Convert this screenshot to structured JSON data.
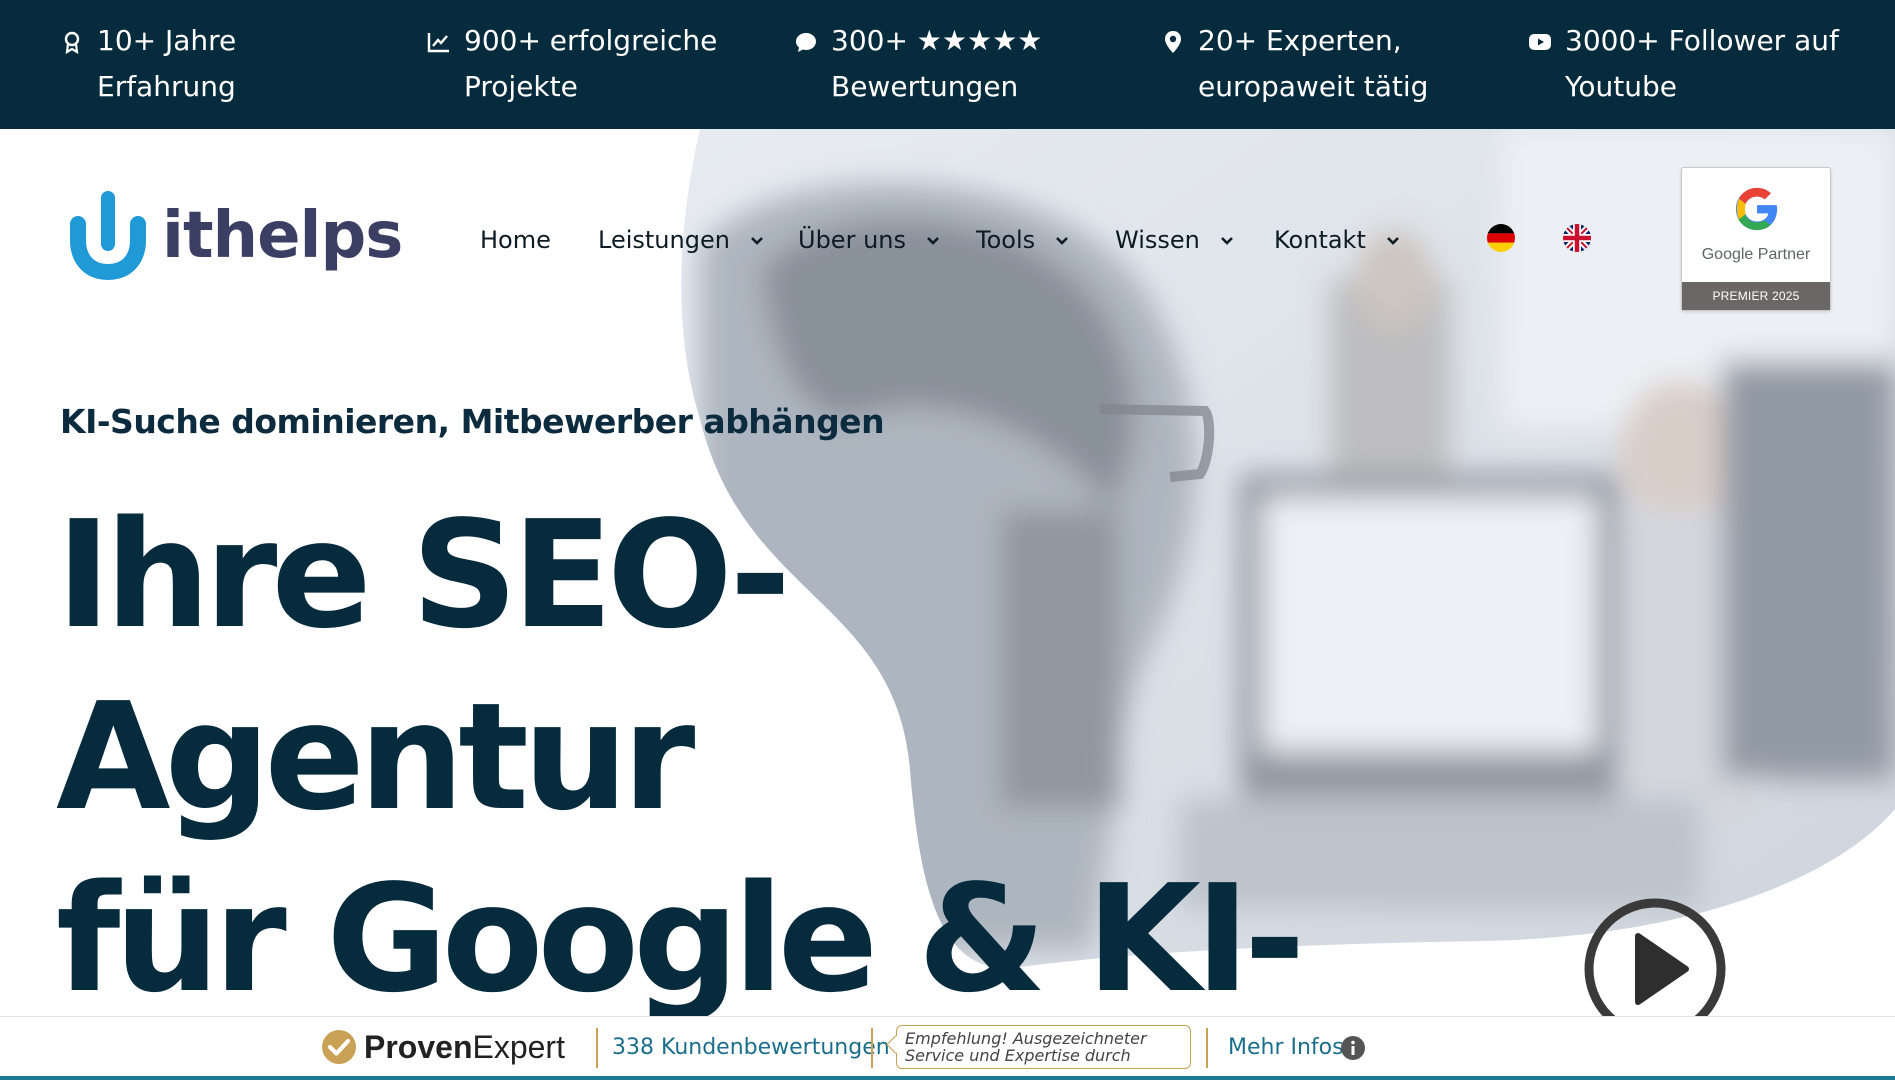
{
  "topbar": {
    "stats": [
      {
        "icon": "award-icon",
        "line1": "10+ Jahre",
        "line2": "Erfahrung"
      },
      {
        "icon": "chart-icon",
        "line1": "900+ erfolgreiche",
        "line2": "Projekte"
      },
      {
        "icon": "chat-bubble-icon",
        "line1": "300+ ★★★★★",
        "line2": "Bewertungen"
      },
      {
        "icon": "location-pin-icon",
        "line1": "20+ Experten,",
        "line2": "europaweit tätig"
      },
      {
        "icon": "youtube-icon",
        "line1": "3000+ Follower auf",
        "line2": "Youtube"
      }
    ]
  },
  "header": {
    "logo_text": "ithelps",
    "nav": [
      {
        "label": "Home",
        "has_dropdown": false
      },
      {
        "label": "Leistungen",
        "has_dropdown": true
      },
      {
        "label": "Über uns",
        "has_dropdown": true
      },
      {
        "label": "Tools",
        "has_dropdown": true
      },
      {
        "label": "Wissen",
        "has_dropdown": true
      },
      {
        "label": "Kontakt",
        "has_dropdown": true
      }
    ],
    "languages": [
      "german-flag-icon",
      "uk-flag-icon"
    ],
    "google_partner": {
      "label": "Google Partner",
      "badge": "PREMIER 2025"
    }
  },
  "hero": {
    "subheadline": "KI-Suche dominieren, Mitbewerber abhängen",
    "headline_lines": [
      "Ihre SEO-",
      "Agentur",
      "für Google & KI-"
    ]
  },
  "proven_expert": {
    "brand_bold": "Proven",
    "brand_regular": "Expert",
    "reviews": "338 Kundenbewertungen",
    "quote_line1": "Empfehlung! Ausgezeichneter",
    "quote_line2": "Service und Expertise durch",
    "more": "Mehr Infos"
  },
  "colors": {
    "topbar_bg": "#062b3d",
    "headline": "#062b3d",
    "accent_blue": "#1f9ad6",
    "proven_gold": "#c9a255",
    "link_teal": "#1b6f8c"
  }
}
